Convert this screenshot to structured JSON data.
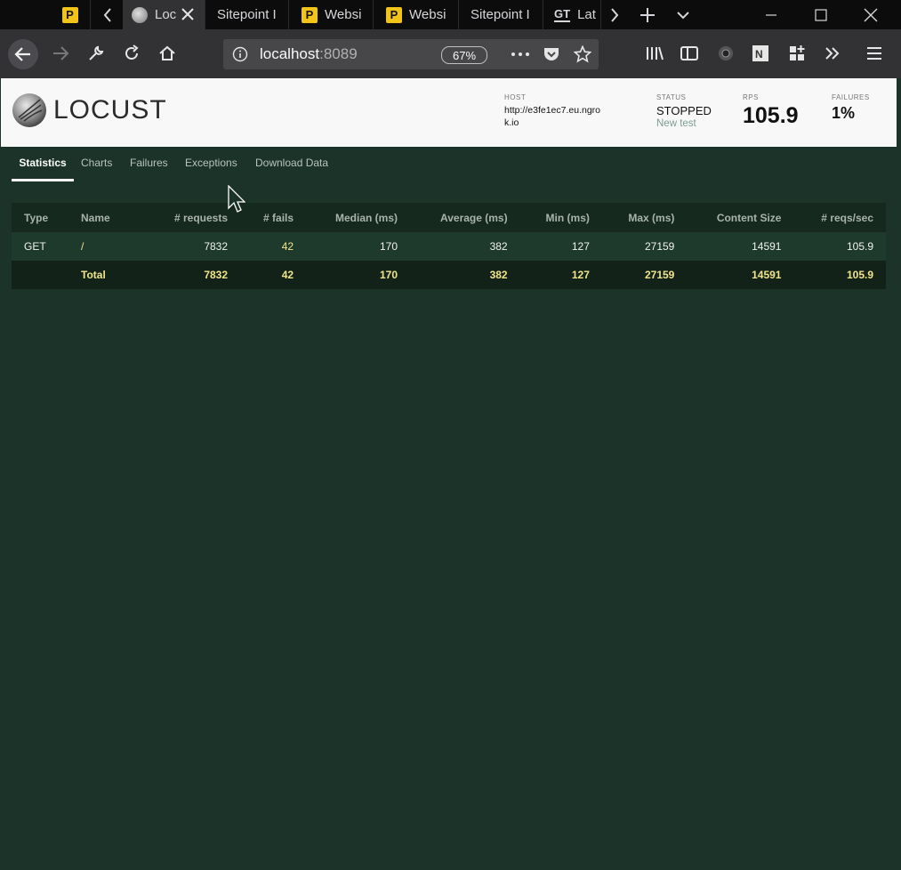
{
  "browser": {
    "tabs": [
      {
        "label": ""
      },
      {
        "label": "Loc"
      },
      {
        "label": "Sitepoint I"
      },
      {
        "label": "Websi"
      },
      {
        "label": "Websi"
      },
      {
        "label": "Sitepoint I"
      },
      {
        "label": "Lat"
      }
    ],
    "url_host": "localhost",
    "url_port": ":8089",
    "zoom": "67%"
  },
  "locust": {
    "logo_text": "LOCUST",
    "host_label": "HOST",
    "host_value": "http://e3fe1ec7.eu.ngrok.io",
    "status_label": "STATUS",
    "status_value": "STOPPED",
    "new_test": "New test",
    "rps_label": "RPS",
    "rps_value": "105.9",
    "failures_label": "FAILURES",
    "failures_value": "1%"
  },
  "nav": [
    {
      "label": "Statistics"
    },
    {
      "label": "Charts"
    },
    {
      "label": "Failures"
    },
    {
      "label": "Exceptions"
    },
    {
      "label": "Download Data"
    }
  ],
  "table": {
    "headers": [
      "Type",
      "Name",
      "# requests",
      "# fails",
      "Median (ms)",
      "Average (ms)",
      "Min (ms)",
      "Max (ms)",
      "Content Size",
      "# reqs/sec"
    ],
    "rows": [
      [
        "GET",
        "/",
        "7832",
        "42",
        "170",
        "382",
        "127",
        "27159",
        "14591",
        "105.9"
      ]
    ],
    "total": [
      "",
      "Total",
      "7832",
      "42",
      "170",
      "382",
      "127",
      "27159",
      "14591",
      "105.9"
    ]
  },
  "colors": {
    "page_background": "#1b3328",
    "accent_yellow": "#f0e58a",
    "header_background": "#f8f8f8"
  }
}
